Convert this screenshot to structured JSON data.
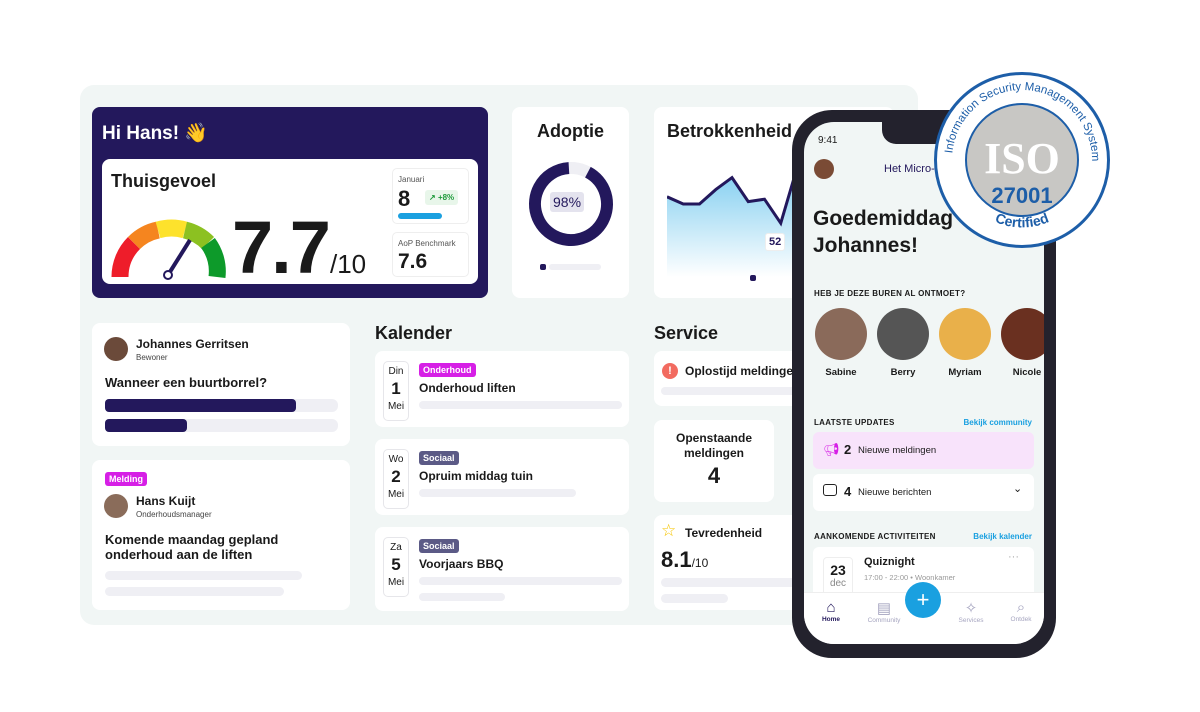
{
  "welcome": {
    "greeting": "Hi Hans! 👋"
  },
  "thuisgevoel": {
    "title": "Thuisgevoel",
    "score": "7.7",
    "scale": "/10",
    "gauge_value": 7.7,
    "month_label": "Januari",
    "month_value": "8",
    "change": "+8%",
    "benchmark_label": "AoP Benchmark",
    "benchmark_value": "7.6"
  },
  "adoptie": {
    "title": "Adoptie",
    "value": "98%",
    "percent": 98
  },
  "betrokkenheid": {
    "title": "Betrokkenheid",
    "point_label": "52"
  },
  "chart_data": {
    "type": "area",
    "title": "Betrokkenheid",
    "values": [
      63,
      60,
      60,
      66,
      71,
      61,
      62,
      52,
      75
    ],
    "annotations": [
      "52"
    ]
  },
  "poll": {
    "name": "Johannes Gerritsen",
    "role": "Bewoner",
    "question": "Wanneer een buurtborrel?",
    "options": [
      0.82,
      0.35
    ]
  },
  "melding": {
    "tag": "Melding",
    "name": "Hans Kuijt",
    "role": "Onderhoudsmanager",
    "message": "Komende maandag gepland onderhoud aan de liften"
  },
  "kalender": {
    "title": "Kalender",
    "items": [
      {
        "day": "Din",
        "date": "1",
        "month": "Mei",
        "tag": "Onderhoud",
        "tag_color": "#d61fe6",
        "title": "Onderhoud liften"
      },
      {
        "day": "Wo",
        "date": "2",
        "month": "Mei",
        "tag": "Sociaal",
        "tag_color": "#5b5a86",
        "title": "Opruim middag tuin"
      },
      {
        "day": "Za",
        "date": "5",
        "month": "Mei",
        "tag": "Sociaal",
        "tag_color": "#5b5a86",
        "title": "Voorjaars BBQ"
      }
    ]
  },
  "service": {
    "title": "Service",
    "oplostijd": "Oplostijd meldingen",
    "open_label": "Openstaande meldingen",
    "open_value": "4",
    "tevreden_label": "Tevredenheid",
    "tevreden_value": "8.1",
    "tevreden_scale": "/10"
  },
  "phone": {
    "time": "9:41",
    "org": "Het Micro-",
    "greeting": "Goedemiddag Johannes!",
    "neighbours_title": "HEB JE DEZE BUREN AL ONTMOET?",
    "neighbours": [
      "Sabine",
      "Berry",
      "Myriam",
      "Nicole"
    ],
    "updates_title": "LAATSTE UPDATES",
    "updates_link": "Bekijk community",
    "updates": [
      {
        "count": "2",
        "label": "Nieuwe meldingen"
      },
      {
        "count": "4",
        "label": "Nieuwe berichten"
      }
    ],
    "activities_title": "AANKOMENDE ACTIVITEITEN",
    "activities_link": "Bekijk kalender",
    "activity": {
      "date": "23",
      "month": "dec",
      "title": "Quiznight",
      "time": "17:00 - 22:00 • Woonkamer"
    },
    "nav": [
      "Home",
      "Community",
      "Services",
      "Ontdek"
    ]
  },
  "iso": {
    "ring_text": "Information Security Management System",
    "mark": "ISO",
    "number": "27001",
    "certified": "Certified"
  },
  "colors": {
    "navy": "#23185c",
    "blue": "#1aa0e0",
    "magenta": "#d61fe6",
    "iso_blue": "#1d5ea8"
  }
}
